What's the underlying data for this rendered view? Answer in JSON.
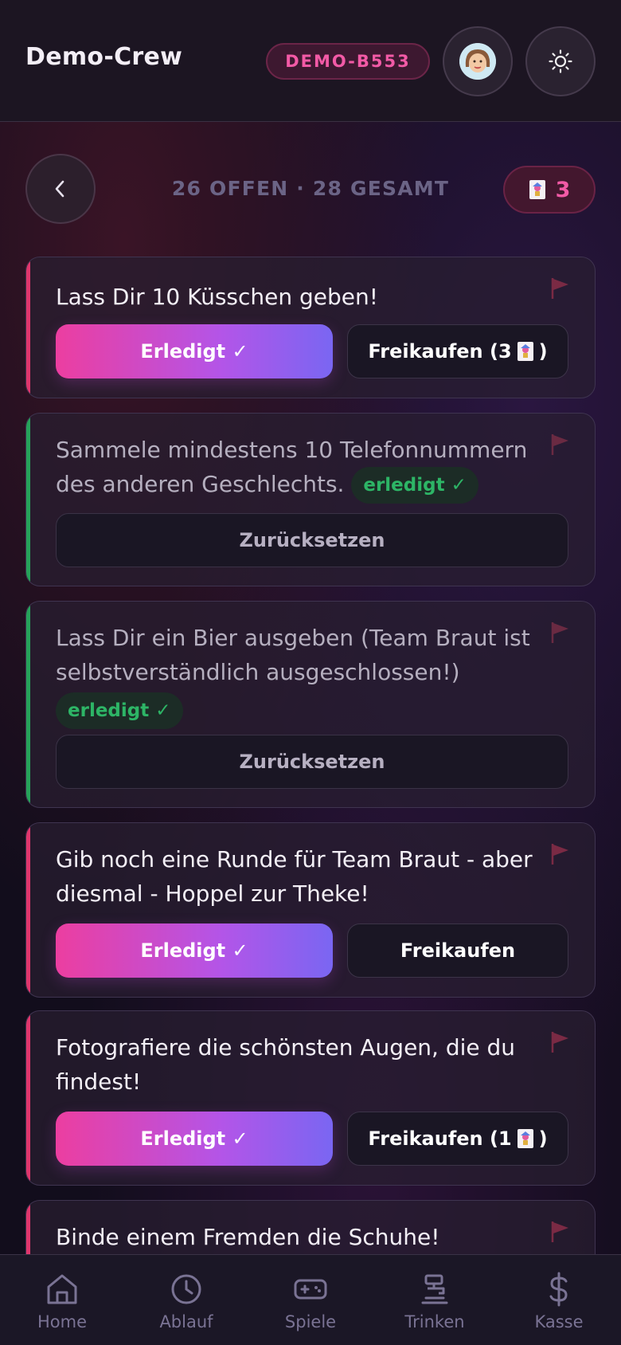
{
  "header": {
    "title": "Demo-Crew",
    "group_code": "DEMO-B553"
  },
  "summary": {
    "text": "26 OFFEN · 28 GESAMT",
    "token_count": "3"
  },
  "tasks": [
    {
      "status": "open",
      "text": "Lass Dir 10 Küsschen geben!",
      "done_label": "Erledigt ✓",
      "buyout_label": "Freikaufen (3",
      "buyout_suffix": ")"
    },
    {
      "status": "done",
      "text": "Sammele mindestens 10 Telefonnummern des anderen Geschlechts.",
      "done_badge": "erledigt ✓",
      "reset_label": "Zurücksetzen"
    },
    {
      "status": "done",
      "text": "Lass Dir ein Bier ausgeben (Team Braut ist selbstverständlich ausgeschlossen!)",
      "done_badge": "erledigt ✓",
      "reset_label": "Zurücksetzen"
    },
    {
      "status": "open",
      "text": "Gib noch eine Runde für Team Braut - aber diesmal - Hoppel zur Theke!",
      "done_label": "Erledigt ✓",
      "buyout_label": "Freikaufen"
    },
    {
      "status": "open",
      "text": "Fotografiere die schönsten Augen, die du findest!",
      "done_label": "Erledigt ✓",
      "buyout_label": "Freikaufen (1",
      "buyout_suffix": ")"
    },
    {
      "status": "open",
      "text": "Binde einem Fremden die Schuhe!"
    }
  ],
  "nav": {
    "items": [
      {
        "label": "Home",
        "icon": "home-icon"
      },
      {
        "label": "Ablauf",
        "icon": "clock-icon"
      },
      {
        "label": "Spiele",
        "icon": "gamepad-icon"
      },
      {
        "label": "Trinken",
        "icon": "beer-tap-icon"
      },
      {
        "label": "Kasse",
        "icon": "dollar-icon"
      }
    ]
  },
  "colors": {
    "accent_pink": "#f25aa6",
    "open_border": "#e0366d",
    "done_border": "#26a25a",
    "done_text": "#2db566"
  }
}
